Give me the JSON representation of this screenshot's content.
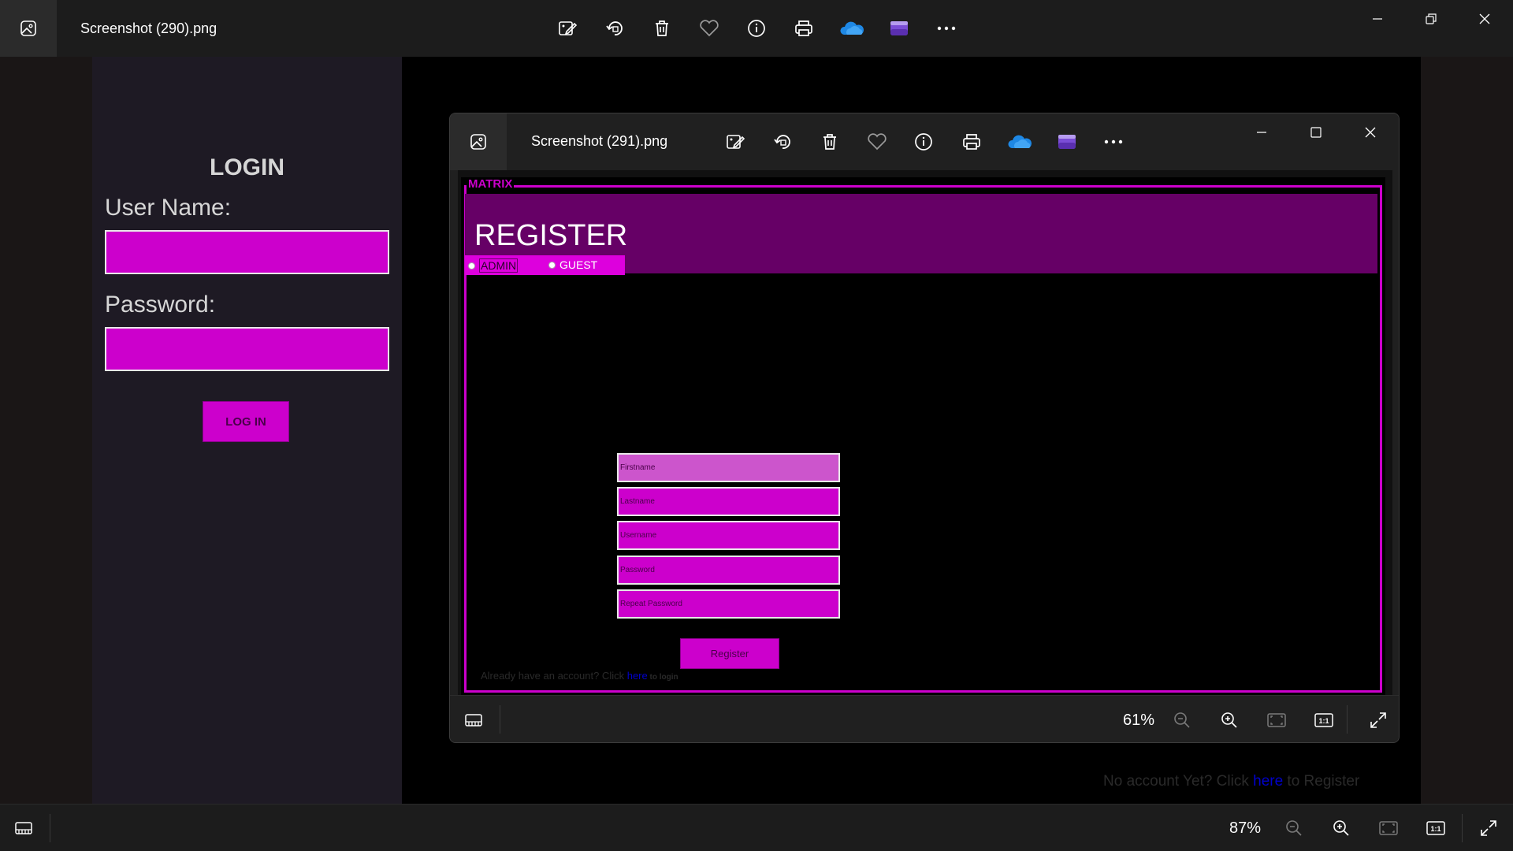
{
  "outer": {
    "title": "Screenshot (290).png",
    "toolbar": [
      "edit-image-icon",
      "rotate-icon",
      "delete-icon",
      "favorite-icon",
      "info-icon",
      "print-icon",
      "onedrive-icon",
      "clipchamp-icon",
      "more-icon"
    ],
    "zoom": "87%"
  },
  "login_page": {
    "title": "LOGIN",
    "username_label": "User Name:",
    "password_label": "Password:",
    "button": "LOG IN",
    "no_account_prefix": "No account Yet? Click ",
    "no_account_link": "here",
    "no_account_suffix": " to Register"
  },
  "inner": {
    "title": "Screenshot (291).png",
    "zoom": "61%"
  },
  "register_page": {
    "frame_legend": "MATRIX",
    "title": "REGISTER",
    "roles": [
      "ADMIN",
      "GUEST"
    ],
    "fields": [
      "Firstname",
      "Lastname",
      "Username",
      "Password",
      "Repeat Password"
    ],
    "button": "Register",
    "login_prefix": "Already have an account? Click ",
    "login_link": "here",
    "login_suffix": " to login"
  },
  "colors": {
    "magenta": "#cc00cc",
    "header_purple": "#660066",
    "link_blue": "#0000cc"
  }
}
